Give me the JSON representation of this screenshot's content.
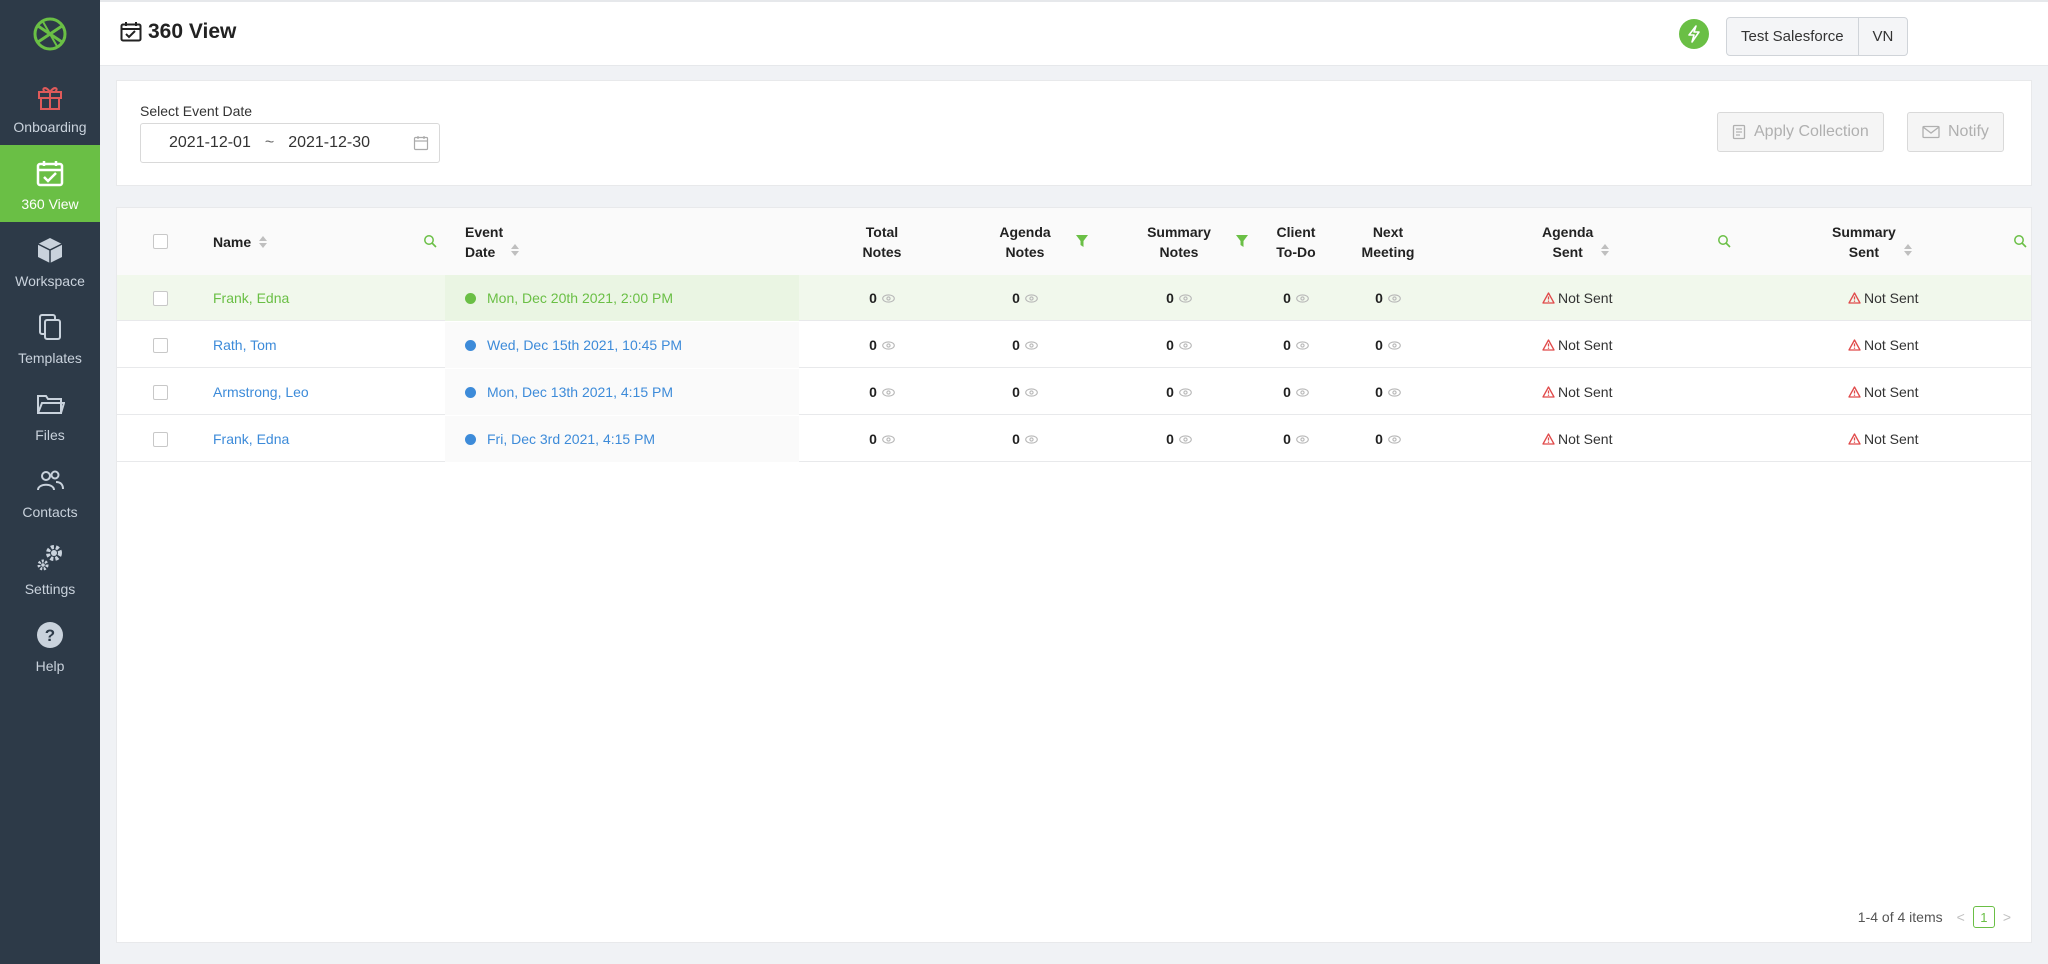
{
  "colors": {
    "accent": "#6abf45",
    "sidebar": "#2d3a48",
    "link": "#3d8bd9",
    "warning": "#e04a4a"
  },
  "sidebar": {
    "items": [
      {
        "label": "Onboarding",
        "icon": "gift-icon"
      },
      {
        "label": "360 View",
        "icon": "calendar-check-icon"
      },
      {
        "label": "Workspace",
        "icon": "cube-icon"
      },
      {
        "label": "Templates",
        "icon": "copy-icon"
      },
      {
        "label": "Files",
        "icon": "folder-icon"
      },
      {
        "label": "Contacts",
        "icon": "users-icon"
      },
      {
        "label": "Settings",
        "icon": "gears-icon"
      },
      {
        "label": "Help",
        "icon": "question-icon"
      }
    ]
  },
  "header": {
    "title": "360 View",
    "org_label": "Test Salesforce",
    "user_initials": "VN"
  },
  "filter": {
    "label": "Select Event Date",
    "start_date": "2021-12-01",
    "separator": "~",
    "end_date": "2021-12-30",
    "apply_collection_label": "Apply Collection",
    "notify_label": "Notify"
  },
  "table": {
    "columns": {
      "name": "Name",
      "event_date_1": "Event",
      "event_date_2": "Date",
      "total_notes_1": "Total",
      "total_notes_2": "Notes",
      "agenda_notes_1": "Agenda",
      "agenda_notes_2": "Notes",
      "summary_notes_1": "Summary",
      "summary_notes_2": "Notes",
      "client_todo_1": "Client",
      "client_todo_2": "To-Do",
      "next_meeting_1": "Next",
      "next_meeting_2": "Meeting",
      "agenda_sent_1": "Agenda",
      "agenda_sent_2": "Sent",
      "summary_sent_1": "Summary",
      "summary_sent_2": "Sent"
    },
    "rows": [
      {
        "name": "Frank, Edna",
        "event_date": "Mon, Dec 20th 2021, 2:00 PM",
        "status_color": "#6abf45",
        "total_notes": "0",
        "agenda_notes": "0",
        "summary_notes": "0",
        "client_todo": "0",
        "next_meeting": "0",
        "agenda_sent": "Not Sent",
        "summary_sent": "Not Sent"
      },
      {
        "name": "Rath, Tom",
        "event_date": "Wed, Dec 15th 2021, 10:45 PM",
        "status_color": "#3d8bd9",
        "total_notes": "0",
        "agenda_notes": "0",
        "summary_notes": "0",
        "client_todo": "0",
        "next_meeting": "0",
        "agenda_sent": "Not Sent",
        "summary_sent": "Not Sent"
      },
      {
        "name": "Armstrong, Leo",
        "event_date": "Mon, Dec 13th 2021, 4:15 PM",
        "status_color": "#3d8bd9",
        "total_notes": "0",
        "agenda_notes": "0",
        "summary_notes": "0",
        "client_todo": "0",
        "next_meeting": "0",
        "agenda_sent": "Not Sent",
        "summary_sent": "Not Sent"
      },
      {
        "name": "Frank, Edna",
        "event_date": "Fri, Dec 3rd 2021, 4:15 PM",
        "status_color": "#3d8bd9",
        "total_notes": "0",
        "agenda_notes": "0",
        "summary_notes": "0",
        "client_todo": "0",
        "next_meeting": "0",
        "agenda_sent": "Not Sent",
        "summary_sent": "Not Sent"
      }
    ]
  },
  "pagination": {
    "summary": "1-4 of 4 items",
    "current_page": "1",
    "prev": "<",
    "next": ">"
  }
}
